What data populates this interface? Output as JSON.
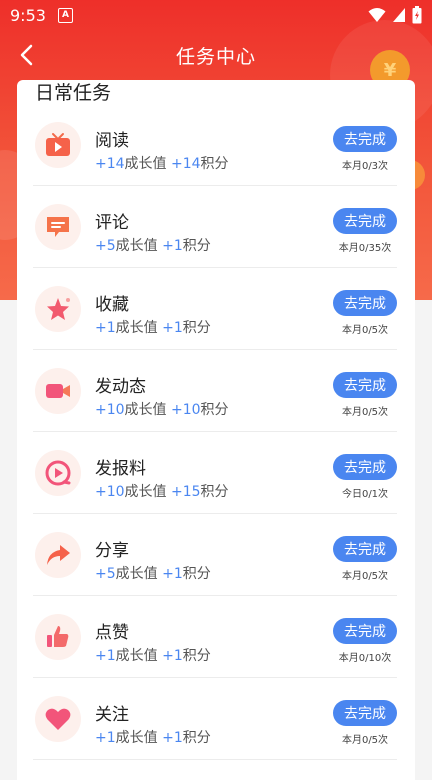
{
  "status_bar": {
    "time": "9:53",
    "app_badge": "A"
  },
  "header": {
    "title": "任务中心",
    "back_icon": "back-arrow-icon"
  },
  "section": {
    "title": "日常任务"
  },
  "labels": {
    "growth": "成长值",
    "points": "积分"
  },
  "colors": {
    "accent": "#4a86f0",
    "header_red": "#ee2f2a"
  },
  "tasks": [
    {
      "name": "阅读",
      "icon": "tv-icon",
      "growth": "+14",
      "points": "+14",
      "button": "去完成",
      "progress": "本月0/3次"
    },
    {
      "name": "评论",
      "icon": "comment-icon",
      "growth": "+5",
      "points": "+1",
      "button": "去完成",
      "progress": "本月0/35次"
    },
    {
      "name": "收藏",
      "icon": "star-icon",
      "growth": "+1",
      "points": "+1",
      "button": "去完成",
      "progress": "本月0/5次"
    },
    {
      "name": "发动态",
      "icon": "video-camera-icon",
      "growth": "+10",
      "points": "+10",
      "button": "去完成",
      "progress": "本月0/5次"
    },
    {
      "name": "发报料",
      "icon": "play-circle-icon",
      "growth": "+10",
      "points": "+15",
      "button": "去完成",
      "progress": "今日0/1次"
    },
    {
      "name": "分享",
      "icon": "share-icon",
      "growth": "+5",
      "points": "+1",
      "button": "去完成",
      "progress": "本月0/5次"
    },
    {
      "name": "点赞",
      "icon": "thumbs-up-icon",
      "growth": "+1",
      "points": "+1",
      "button": "去完成",
      "progress": "本月0/10次"
    },
    {
      "name": "关注",
      "icon": "heart-icon",
      "growth": "+1",
      "points": "+1",
      "button": "去完成",
      "progress": "本月0/5次"
    }
  ]
}
